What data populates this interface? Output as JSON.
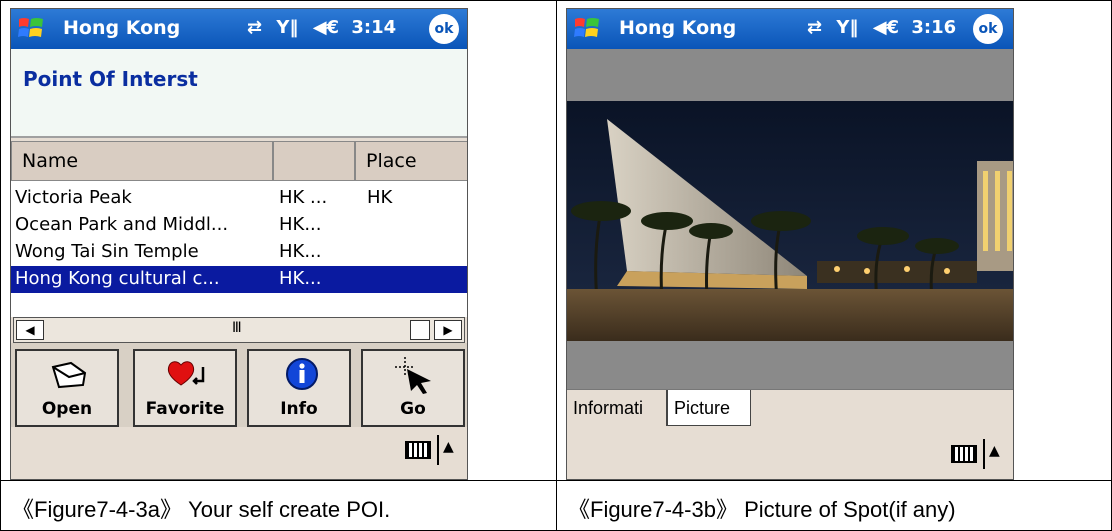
{
  "left_screen": {
    "titlebar": {
      "title": "Hong Kong",
      "time": "3:14",
      "ok": "ok"
    },
    "header": "Point Of Interst",
    "columns": [
      "Name",
      "",
      "Place"
    ],
    "rows": [
      {
        "name": "Victoria Peak",
        "col2": "HK ...",
        "place": "HK",
        "selected": false
      },
      {
        "name": "Ocean Park and Middl...",
        "col2": "HK...",
        "place": "",
        "selected": false
      },
      {
        "name": "Wong Tai Sin Temple",
        "col2": "HK...",
        "place": "",
        "selected": false
      },
      {
        "name": "Hong Kong cultural c...",
        "col2": "HK...",
        "place": "",
        "selected": true
      }
    ],
    "scrollbar": {
      "left": "◀",
      "mid": "Ⅲ",
      "right": "▶"
    },
    "toolbar": [
      {
        "label": "Open",
        "icon": "envelope-icon"
      },
      {
        "label": "Favorite",
        "icon": "heart-icon"
      },
      {
        "label": "Info",
        "icon": "info-icon"
      },
      {
        "label": "Go",
        "icon": "cursor-target-icon"
      }
    ]
  },
  "right_screen": {
    "titlebar": {
      "title": "Hong Kong",
      "time": "3:16",
      "ok": "ok"
    },
    "tabs": [
      {
        "label": "Informati",
        "active": false
      },
      {
        "label": "Picture",
        "active": true
      }
    ]
  },
  "captions": {
    "left": "《Figure7-4-3a》 Your self create POI.",
    "right": "《Figure7-4-3b》 Picture of Spot(if any)"
  },
  "status_icons": "⇄ Y‖ ◀€"
}
